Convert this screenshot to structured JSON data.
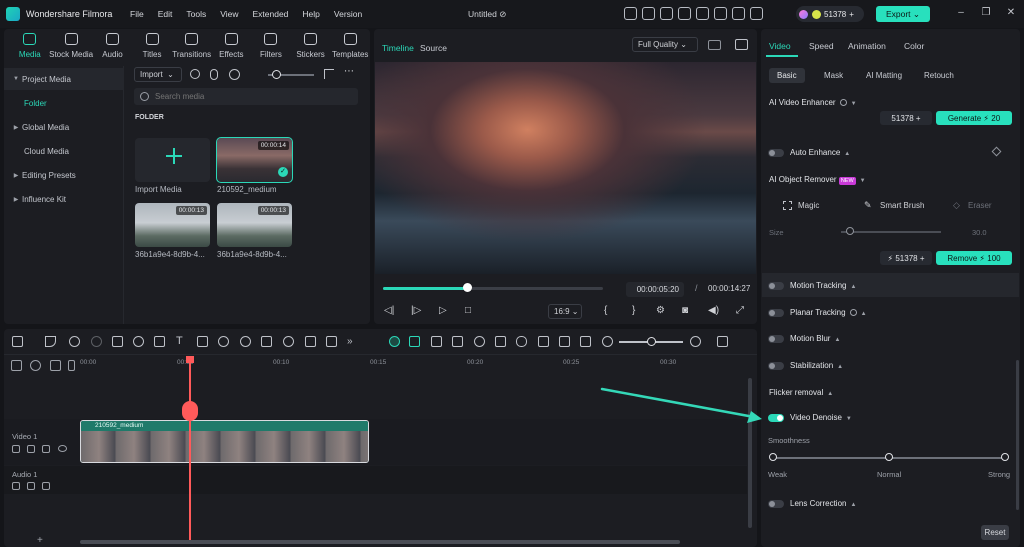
{
  "app": {
    "name": "Wondershare Filmora",
    "document": "Untitled"
  },
  "menu": [
    "File",
    "Edit",
    "Tools",
    "View",
    "Extended",
    "Help",
    "Version"
  ],
  "credits": "51378",
  "export_label": "Export",
  "media_tabs": [
    "Media",
    "Stock Media",
    "Audio",
    "Titles",
    "Transitions",
    "Effects",
    "Filters",
    "Stickers",
    "Templates"
  ],
  "media_sidebar": [
    "Project Media",
    "Folder",
    "Global Media",
    "Cloud Media",
    "Editing Presets",
    "Influence Kit"
  ],
  "import_label": "Import",
  "search_placeholder": "Search media",
  "folder_label": "FOLDER",
  "tiles": [
    {
      "name": "Import Media"
    },
    {
      "name": "210592_medium",
      "duration": "00:00:14"
    },
    {
      "name": "36b1a9e4-8d9b-4...",
      "duration": "00:00:13"
    },
    {
      "name": "36b1a9e4-8d9b-4...",
      "duration": "00:00:13"
    }
  ],
  "preview": {
    "tab_timeline": "Timeline",
    "tab_source": "Source",
    "quality": "Full Quality",
    "time_current": "00:00:05:20",
    "time_separator": "/",
    "time_total": "00:00:14:27",
    "aspect": "16:9",
    "progress": 0.38
  },
  "props": {
    "tabs": [
      "Video",
      "Speed",
      "Animation",
      "Color"
    ],
    "subtabs": [
      "Basic",
      "Mask",
      "AI Matting",
      "Retouch"
    ],
    "ai_video_enhancer": "AI Video Enhancer",
    "credit_chip": "51378",
    "generate_label": "Generate",
    "generate_cost": "20",
    "auto_enhance": "Auto Enhance",
    "ai_object_remover": "AI Object Remover",
    "new_badge": "NEW",
    "magic": "Magic",
    "smart_brush": "Smart Brush",
    "eraser": "Eraser",
    "size_label": "Size",
    "size_value": "30.0",
    "remove_label": "Remove",
    "remove_cost": "100",
    "motion_tracking": "Motion Tracking",
    "planar_tracking": "Planar Tracking",
    "motion_blur": "Motion Blur",
    "stabilization": "Stabilization",
    "flicker_removal": "Flicker removal",
    "video_denoise": "Video Denoise",
    "smoothness": "Smoothness",
    "smooth_weak": "Weak",
    "smooth_normal": "Normal",
    "smooth_strong": "Strong",
    "lens_correction": "Lens Correction",
    "reset_label": "Reset"
  },
  "timeline": {
    "ticks": [
      "00:00",
      "00:05",
      "00:10",
      "00:15",
      "00:20",
      "00:25",
      "00:30"
    ],
    "video_track": "Video 1",
    "audio_track": "Audio 1",
    "clip_name": "210592_medium"
  },
  "colors": {
    "accent": "#2bd8b8",
    "playhead": "#ff5a5a",
    "export": "#28e0bd"
  }
}
